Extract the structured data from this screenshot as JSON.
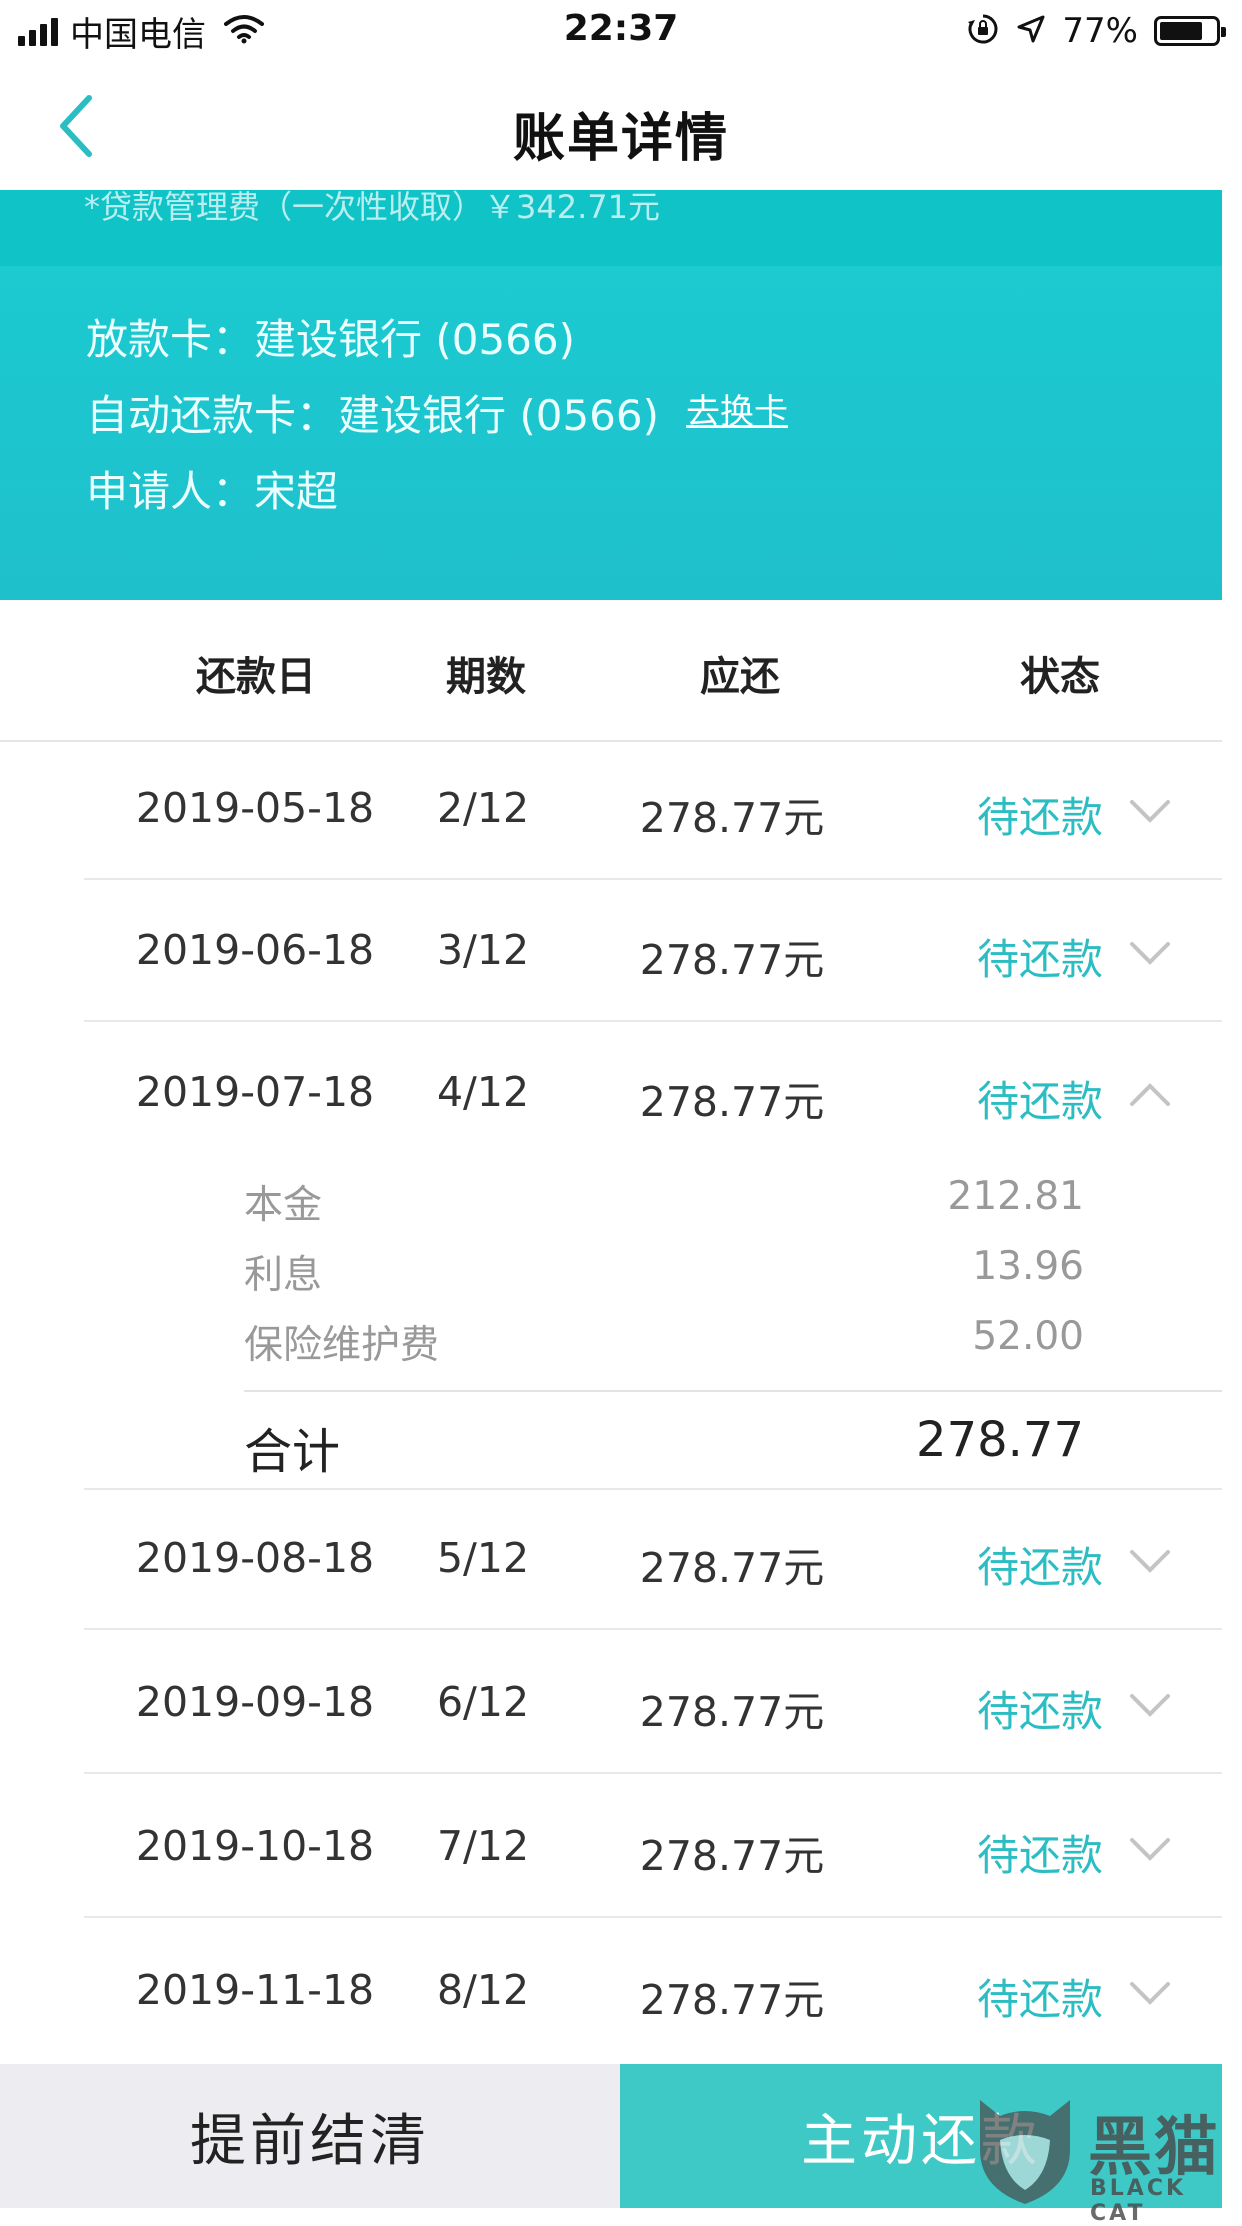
{
  "status_bar": {
    "carrier": "中国电信",
    "time": "22:37",
    "battery_percent": "77%",
    "battery_level": 0.77,
    "icons": [
      "signal-icon",
      "wifi-icon",
      "rotation-lock-icon",
      "location-icon",
      "battery-icon"
    ]
  },
  "nav": {
    "title": "账单详情",
    "back_icon": "chevron-left-icon"
  },
  "header": {
    "fee_note": "*贷款管理费（一次性收取）￥342.71元",
    "disburse_card": "放款卡：建设银行 (0566)",
    "auto_repay_card": "自动还款卡：建设银行 (0566)",
    "change_card_link": "去换卡",
    "applicant": "申请人：宋超"
  },
  "table": {
    "headers": {
      "date": "还款日",
      "period": "期数",
      "amount": "应还",
      "status": "状态"
    },
    "rows": [
      {
        "date": "2019-05-18",
        "period": "2/12",
        "amount": "278.77元",
        "status": "待还款",
        "expanded": false
      },
      {
        "date": "2019-06-18",
        "period": "3/12",
        "amount": "278.77元",
        "status": "待还款",
        "expanded": false
      },
      {
        "date": "2019-07-18",
        "period": "4/12",
        "amount": "278.77元",
        "status": "待还款",
        "expanded": true
      },
      {
        "date": "2019-08-18",
        "period": "5/12",
        "amount": "278.77元",
        "status": "待还款",
        "expanded": false
      },
      {
        "date": "2019-09-18",
        "period": "6/12",
        "amount": "278.77元",
        "status": "待还款",
        "expanded": false
      },
      {
        "date": "2019-10-18",
        "period": "7/12",
        "amount": "278.77元",
        "status": "待还款",
        "expanded": false
      },
      {
        "date": "2019-11-18",
        "period": "8/12",
        "amount": "278.77元",
        "status": "待还款",
        "expanded": false
      }
    ],
    "detail": {
      "items": [
        {
          "label": "本金",
          "value": "212.81"
        },
        {
          "label": "利息",
          "value": "13.96"
        },
        {
          "label": "保险维护费",
          "value": "52.00"
        }
      ],
      "total_label": "合计",
      "total_value": "278.77"
    }
  },
  "actions": {
    "settle_early": "提前结清",
    "repay_now": "主动还款"
  },
  "watermark": {
    "text": "黑猫",
    "sub": "BLACK CAT"
  },
  "colors": {
    "teal": "#1ccad0",
    "teal_button": "#3ec9c7",
    "status_text": "#2bbdc2",
    "back_arrow": "#2bbdc2"
  }
}
